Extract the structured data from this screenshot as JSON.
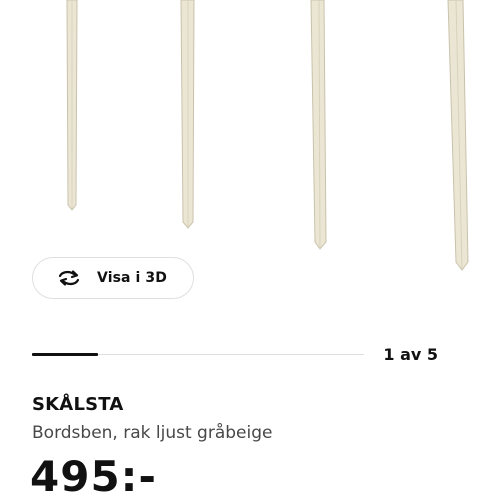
{
  "product_image": {
    "alt": "SKÅLSTA table legs",
    "leg_color": "#ebe6d4"
  },
  "view_3d_button": {
    "icon": "rotate-3d-icon",
    "label": "Visa i 3D"
  },
  "carousel": {
    "current": 1,
    "total": 5,
    "indicator_text": "1 av 5"
  },
  "product": {
    "name": "SKÅLSTA",
    "description": "Bordsben, rak ljust gråbeige",
    "price": "495:-"
  }
}
